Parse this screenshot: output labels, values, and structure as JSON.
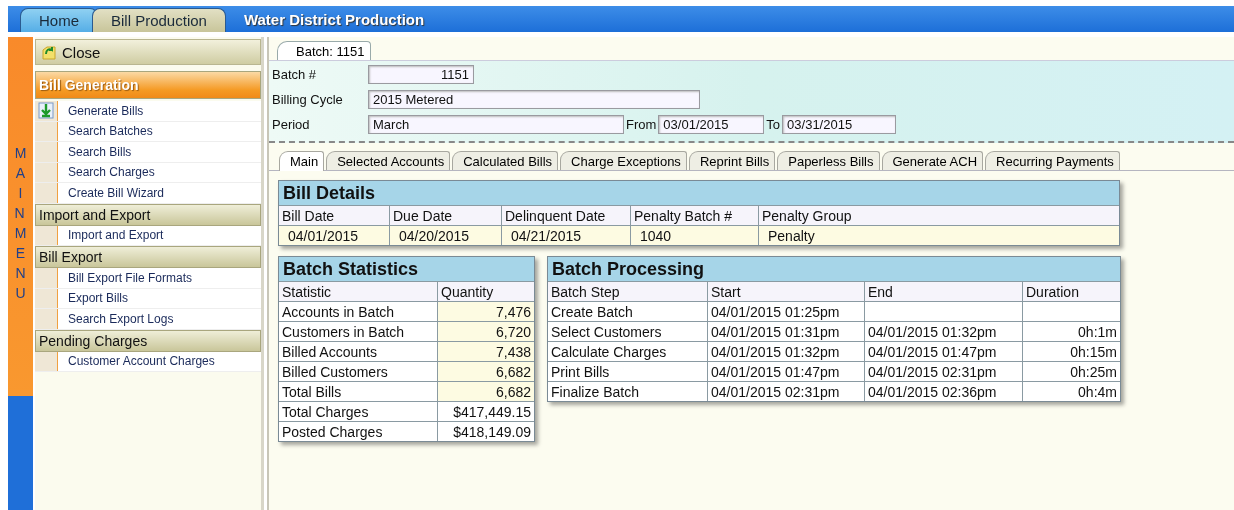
{
  "top_tabs": [
    {
      "label": "Home",
      "selected": false
    },
    {
      "label": "Bill Production",
      "selected": true
    }
  ],
  "app_title": "Water District Production",
  "menu_strip_label": "MAIN MENU",
  "sidebar": {
    "close": "Close",
    "groups": [
      {
        "title": "Bill Generation",
        "selected": true,
        "items": [
          {
            "label": "Generate Bills",
            "has_icon": true
          },
          {
            "label": "Search Batches",
            "has_icon": false
          },
          {
            "label": "Search Bills",
            "has_icon": false
          },
          {
            "label": "Search Charges",
            "has_icon": false
          },
          {
            "label": "Create Bill Wizard",
            "has_icon": false
          }
        ]
      },
      {
        "title": "Import and Export",
        "selected": false,
        "items": [
          {
            "label": "Import and Export",
            "has_icon": false
          }
        ]
      },
      {
        "title": "Bill Export",
        "selected": false,
        "items": [
          {
            "label": "Bill Export File Formats",
            "has_icon": false
          },
          {
            "label": "Export Bills",
            "has_icon": false
          },
          {
            "label": "Search Export Logs",
            "has_icon": false
          }
        ]
      },
      {
        "title": "Pending Charges",
        "selected": false,
        "items": [
          {
            "label": "Customer Account Charges",
            "has_icon": false
          }
        ]
      }
    ]
  },
  "batch_tab": "Batch: 1151",
  "header_fields": {
    "batch_number": {
      "label": "Batch #",
      "value": "1151"
    },
    "billing_cycle": {
      "label": "Billing Cycle",
      "value": "2015 Metered"
    },
    "period": {
      "label": "Period",
      "value": "March"
    },
    "from": {
      "label": "From",
      "value": "03/01/2015"
    },
    "to": {
      "label": "To",
      "value": "03/31/2015"
    }
  },
  "tabs": [
    {
      "label": "Main",
      "selected": true
    },
    {
      "label": "Selected Accounts",
      "selected": false
    },
    {
      "label": "Calculated Bills",
      "selected": false
    },
    {
      "label": "Charge Exceptions",
      "selected": false
    },
    {
      "label": "Reprint Bills",
      "selected": false
    },
    {
      "label": "Paperless Bills",
      "selected": false
    },
    {
      "label": "Generate ACH",
      "selected": false
    },
    {
      "label": "Recurring Payments",
      "selected": false
    }
  ],
  "bill_details": {
    "title": "Bill Details",
    "columns": [
      "Bill Date",
      "Due Date",
      "Delinquent Date",
      "Penalty Batch #",
      "Penalty Group"
    ],
    "rows": [
      [
        "04/01/2015",
        "04/20/2015",
        "04/21/2015",
        "1040",
        "Penalty"
      ]
    ]
  },
  "batch_statistics": {
    "title": "Batch Statistics",
    "columns": [
      "Statistic",
      "Quantity"
    ],
    "rows": [
      [
        "Accounts in Batch",
        "7,476"
      ],
      [
        "Customers in Batch",
        "6,720"
      ],
      [
        "Billed Accounts",
        "7,438"
      ],
      [
        "Billed Customers",
        "6,682"
      ],
      [
        "Total Bills",
        "6,682"
      ],
      [
        "Total Charges",
        "$417,449.15"
      ],
      [
        "Posted Charges",
        "$418,149.09"
      ]
    ]
  },
  "batch_processing": {
    "title": "Batch Processing",
    "columns": [
      "Batch Step",
      "Start",
      "End",
      "Duration"
    ],
    "rows": [
      [
        "Create Batch",
        "04/01/2015 01:25pm",
        null,
        null
      ],
      [
        "Select Customers",
        "04/01/2015 01:31pm",
        "04/01/2015 01:32pm",
        "0h:1m"
      ],
      [
        "Calculate Charges",
        "04/01/2015 01:32pm",
        "04/01/2015 01:47pm",
        "0h:15m"
      ],
      [
        "Print Bills",
        "04/01/2015 01:47pm",
        "04/01/2015 02:31pm",
        "0h:25m"
      ],
      [
        "Finalize Batch",
        "04/01/2015 02:31pm",
        "04/01/2015 02:36pm",
        "0h:4m"
      ]
    ]
  }
}
